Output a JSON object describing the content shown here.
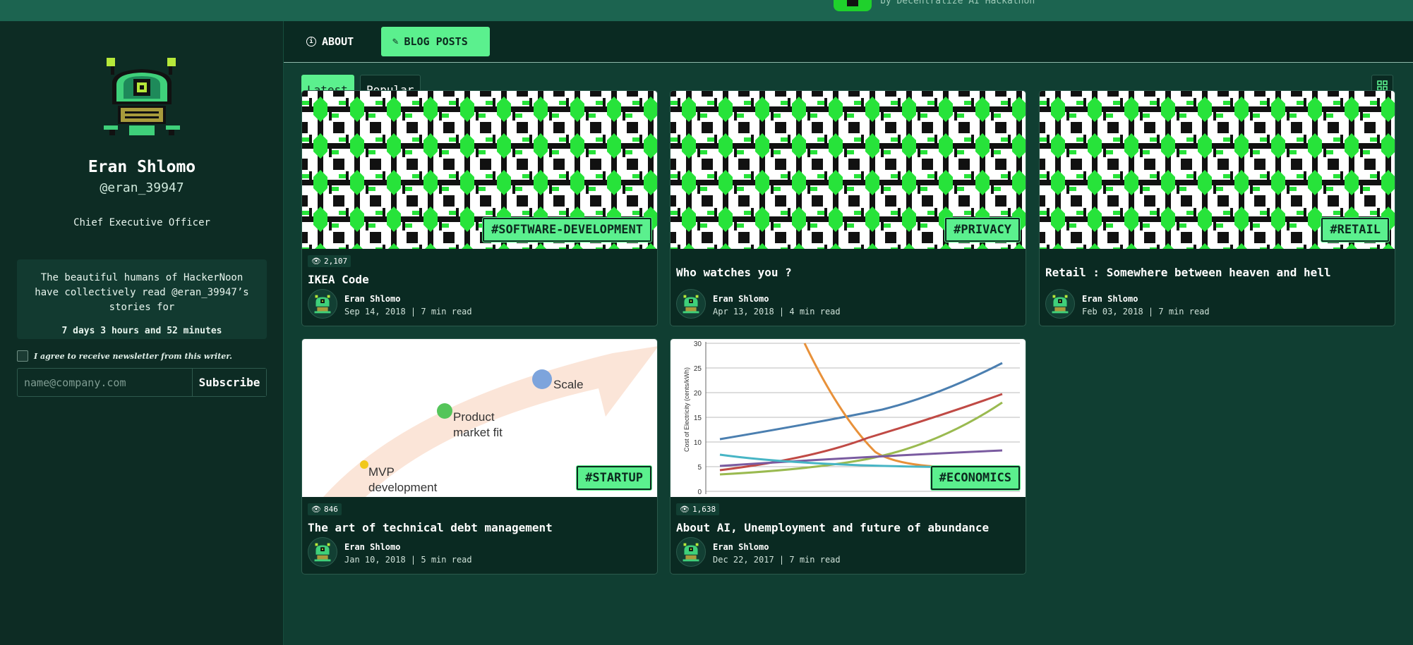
{
  "banner": {
    "subtitle": "by Decentralize AI Hackathon"
  },
  "sidebar": {
    "name": "Eran Shlomo",
    "handle": "@eran_39947",
    "job_title": "Chief Executive Officer",
    "read_stats": {
      "text": "The beautiful humans of HackerNoon have collectively read @eran_39947’s stories for",
      "duration": "7 days 3 hours and 52 minutes"
    },
    "newsletter": {
      "consent_label": "I agree to receive newsletter from this writer.",
      "email_placeholder": "name@company.com",
      "subscribe_label": "Subscribe"
    }
  },
  "tabs": {
    "about": "ABOUT",
    "blog_posts": "BLOG POSTS"
  },
  "filters": {
    "latest": "Latest",
    "popular": "Popular"
  },
  "posts": [
    {
      "tag": "#SOFTWARE-DEVELOPMENT",
      "views": "2,107",
      "title": "IKEA Code",
      "author": "Eran Shlomo",
      "meta": "Sep 14, 2018 | 7 min read"
    },
    {
      "tag": "#PRIVACY",
      "title": "Who watches you ?",
      "author": "Eran Shlomo",
      "meta": "Apr 13, 2018 | 4 min read"
    },
    {
      "tag": "#RETAIL",
      "title": "Retail : Somewhere between heaven and hell",
      "author": "Eran Shlomo",
      "meta": "Feb 03, 2018 | 7 min read"
    },
    {
      "tag": "#STARTUP",
      "views": "846",
      "title": "The art of technical debt management",
      "author": "Eran Shlomo",
      "meta": "Jan 10, 2018 | 5 min read",
      "image_labels": {
        "scale": "Scale",
        "pmf_line1": "Product",
        "pmf_line2": "market fit",
        "mvp_line1": "MVP",
        "mvp_line2": "development"
      }
    },
    {
      "tag": "#ECONOMICS",
      "views": "1,638",
      "title": "About AI, Unemployment and future of abundance",
      "author": "Eran Shlomo",
      "meta": "Dec 22, 2017 | 7 min read",
      "image_labels": {
        "ylabel": "Cost of Electricity (cents/kWh)",
        "yticks": [
          "30",
          "25",
          "20",
          "15",
          "10",
          "5",
          "0"
        ]
      }
    }
  ],
  "colors": {
    "accent": "#5bf08e",
    "background": "#0a2a22",
    "banner": "#1c6450"
  }
}
